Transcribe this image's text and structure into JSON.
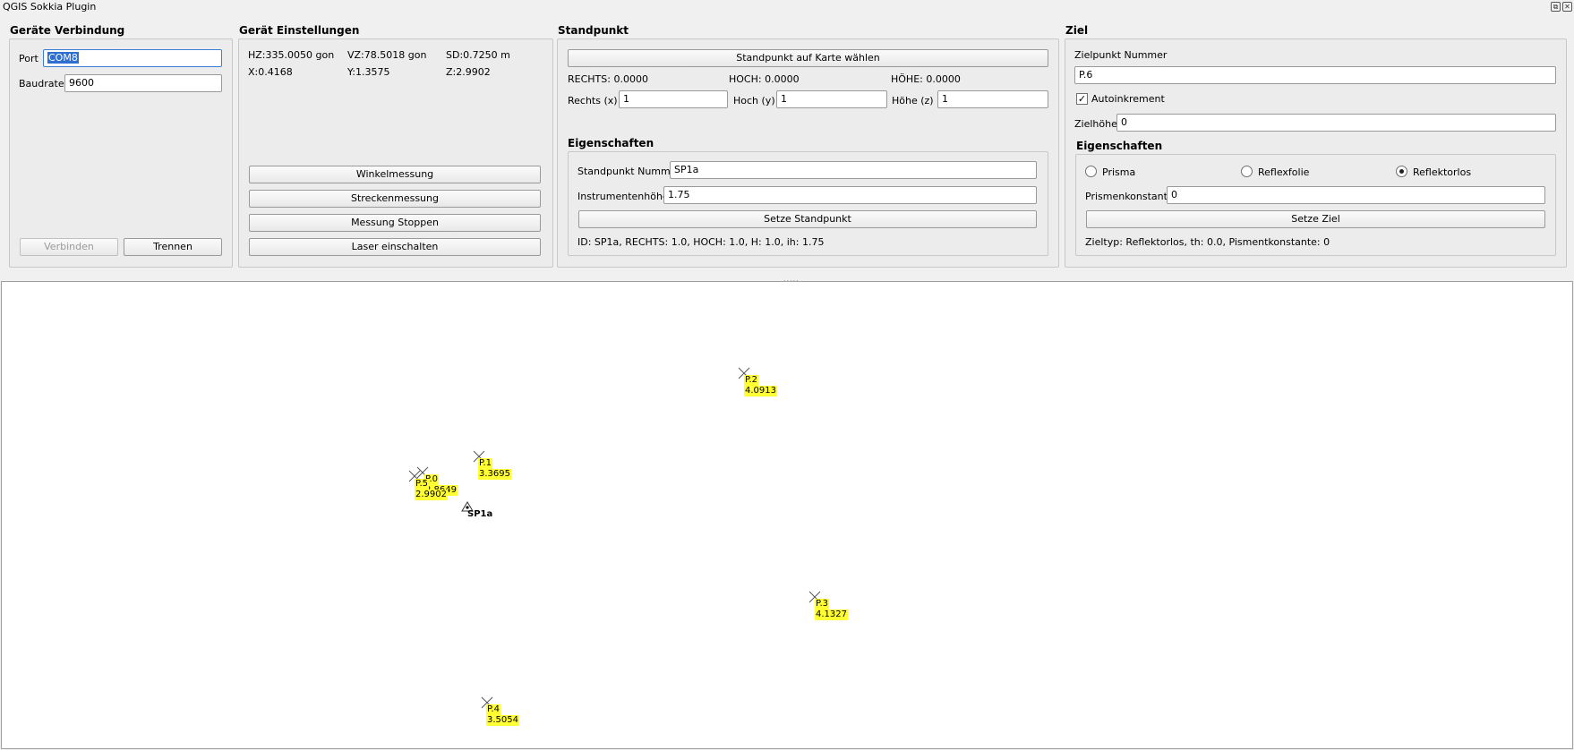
{
  "window": {
    "title": "QGIS Sokkia Plugin",
    "restore_glyph": "⧉",
    "close_glyph": "✕"
  },
  "connection": {
    "title": "Geräte Verbindung",
    "port_label": "Port",
    "port_value": "COM8",
    "baud_label": "Baudrate",
    "baud_value": "9600",
    "connect_label": "Verbinden",
    "disconnect_label": "Trennen"
  },
  "device": {
    "title": "Gerät Einstellungen",
    "hz": "HZ:335.0050 gon",
    "vz": "VZ:78.5018 gon",
    "sd": "SD:0.7250 m",
    "x": "X:0.4168",
    "y": "Y:1.3575",
    "z": "Z:2.9902",
    "angle_btn": "Winkelmessung",
    "distance_btn": "Streckenmessung",
    "stop_btn": "Messung Stoppen",
    "laser_btn": "Laser einschalten"
  },
  "station": {
    "title": "Standpunkt",
    "pick_btn": "Standpunkt auf Karte wählen",
    "rechts": "RECHTS: 0.0000",
    "hoch": "HOCH: 0.0000",
    "hoehe": "HÖHE: 0.0000",
    "x_label": "Rechts (x)",
    "x_value": "1",
    "y_label": "Hoch (y)",
    "y_value": "1",
    "z_label": "Höhe (z)",
    "z_value": "1",
    "props_title": "Eigenschaften",
    "number_label": "Standpunkt Nummer",
    "number_value": "SP1a",
    "height_label": "Instrumentenhöhe",
    "height_value": "1.75",
    "set_btn": "Setze Standpunkt",
    "info": "ID: SP1a, RECHTS: 1.0, HOCH: 1.0, H: 1.0, ih: 1.75"
  },
  "target": {
    "title": "Ziel",
    "number_label": "Zielpunkt Nummer",
    "number_value": "P.6",
    "auto_label": "Autoinkrement",
    "auto_checked": true,
    "height_label": "Zielhöhe",
    "height_value": "0",
    "props_title": "Eigenschaften",
    "radio_prism": "Prisma",
    "radio_foil": "Reflexfolie",
    "radio_reflectorless": "Reflektorlos",
    "selected": "Reflektorlos",
    "const_label": "Prismenkonstante",
    "const_value": "0",
    "set_btn": "Setze Ziel",
    "info": "Zieltyp: Reflektorlos, th: 0.0, Pismentkonstante: 0"
  },
  "splitter": ".....",
  "map": {
    "points": [
      {
        "id": "p2",
        "name": "P.2",
        "value": "4.0913"
      },
      {
        "id": "p1",
        "name": "P.1",
        "value": "3.3695"
      },
      {
        "id": "p0",
        "name": "P.0",
        "value": "2.8649"
      },
      {
        "id": "p5",
        "name": "P.5",
        "value": "2.9902"
      },
      {
        "id": "p3",
        "name": "P.3",
        "value": "4.1327"
      },
      {
        "id": "p4",
        "name": "P.4",
        "value": "3.5054"
      }
    ],
    "station_label": "SP1a",
    "label_color": "#ffff33"
  }
}
